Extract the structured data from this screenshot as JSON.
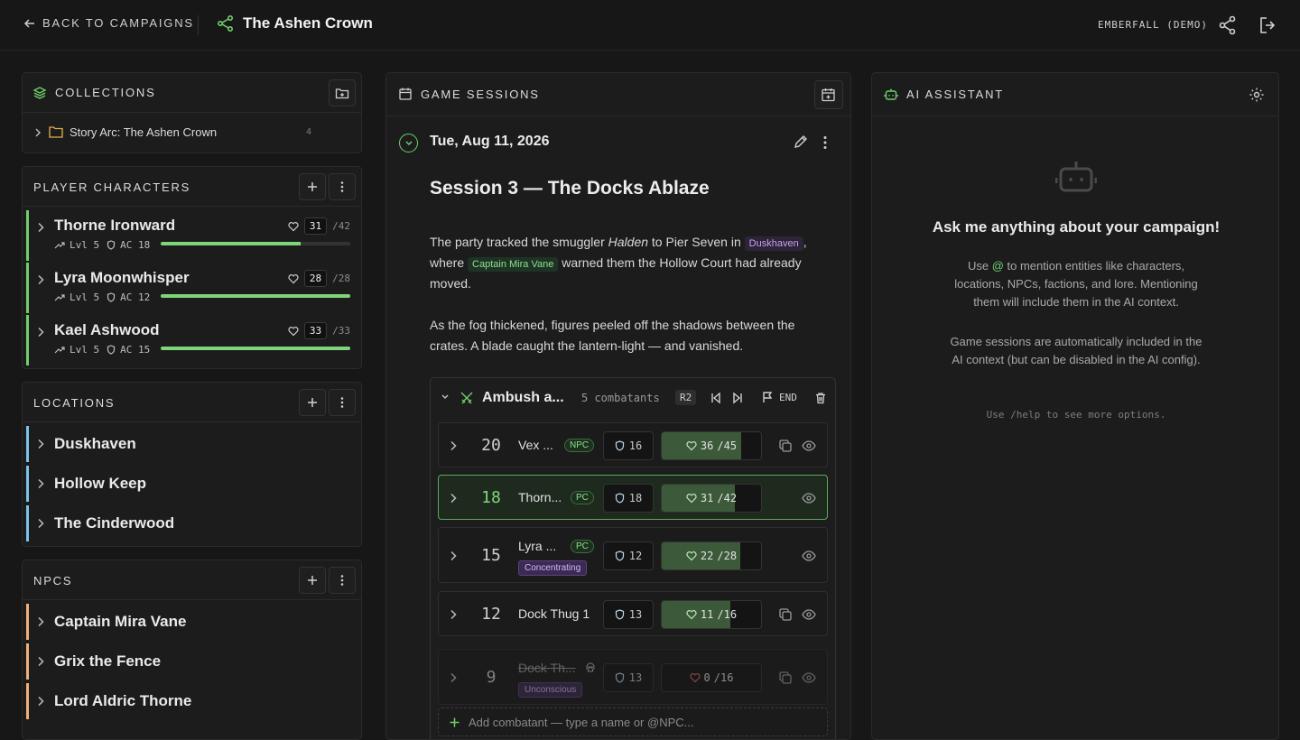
{
  "topbar": {
    "back_label": "BACK TO CAMPAIGNS",
    "campaign_title": "The Ashen Crown",
    "world_label": "EMBERFALL (DEMO)"
  },
  "collections": {
    "header": "COLLECTIONS",
    "items": [
      {
        "label": "Story Arc: The Ashen Crown",
        "count": "4"
      }
    ]
  },
  "player_characters": {
    "header": "PLAYER CHARACTERS",
    "items": [
      {
        "name": "Thorne Ironward",
        "level": "Lvl 5",
        "ac": "AC 18",
        "hp": "31",
        "hp_max": "/42",
        "hp_fraction": 0.74
      },
      {
        "name": "Lyra Moonwhisper",
        "level": "Lvl 5",
        "ac": "AC 12",
        "hp": "28",
        "hp_max": "/28",
        "hp_fraction": 1.0
      },
      {
        "name": "Kael Ashwood",
        "level": "Lvl 5",
        "ac": "AC 15",
        "hp": "33",
        "hp_max": "/33",
        "hp_fraction": 1.0
      }
    ]
  },
  "locations": {
    "header": "LOCATIONS",
    "items": [
      {
        "name": "Duskhaven"
      },
      {
        "name": "Hollow Keep"
      },
      {
        "name": "The Cinderwood"
      }
    ]
  },
  "npcs": {
    "header": "NPCS",
    "items": [
      {
        "name": "Captain Mira Vane"
      },
      {
        "name": "Grix the Fence"
      },
      {
        "name": "Lord Aldric Thorne"
      }
    ]
  },
  "sessions": {
    "header": "GAME SESSIONS",
    "date": "Tue, Aug 11, 2026",
    "title": "Session 3 — The Docks Ablaze",
    "para1_a": "The party tracked the smuggler ",
    "para1_em": "Halden",
    "para1_b": " to Pier Seven in ",
    "para1_tag_loc": "Duskhaven",
    "para1_c": ",",
    "para1_d": "where ",
    "para1_tag_npc": "Captain Mira Vane",
    "para1_e": " warned them the Hollow Court had already moved.",
    "para2": "As the fog thickened, figures peeled off the shadows between the crates. A blade caught the lantern-light — and vanished."
  },
  "combat": {
    "title": "Ambush a...",
    "combatants_label": "5 combatants",
    "round": "R2",
    "end_label": "END",
    "add_placeholder": "Add combatant — type a name or @NPC...",
    "rows": [
      {
        "initiative": "20",
        "name": "Vex ...",
        "badge": "NPC",
        "ac": "16",
        "hp": "36",
        "hp_max": "/45",
        "hp_fraction": 0.8,
        "status": ""
      },
      {
        "initiative": "18",
        "name": "Thorn...",
        "badge": "PC",
        "ac": "18",
        "hp": "31",
        "hp_max": "/42",
        "hp_fraction": 0.74,
        "status": ""
      },
      {
        "initiative": "15",
        "name": "Lyra ...",
        "badge": "PC",
        "ac": "12",
        "hp": "22",
        "hp_max": "/28",
        "hp_fraction": 0.79,
        "status": "Concentrating"
      },
      {
        "initiative": "12",
        "name": "Dock Thug 1",
        "badge": "",
        "ac": "13",
        "hp": "11",
        "hp_max": "/16",
        "hp_fraction": 0.69,
        "status": ""
      },
      {
        "initiative": "9",
        "name": "Dock Th...",
        "badge": "",
        "ac": "13",
        "hp": "0",
        "hp_max": "/16",
        "hp_fraction": 0.0,
        "status": "Unconscious"
      }
    ]
  },
  "assistant": {
    "header": "AI ASSISTANT",
    "headline": "Ask me anything about your campaign!",
    "desc1_a": "Use ",
    "desc1_at": "@",
    "desc1_b": " to mention entities like characters, locations, NPCs, factions, and lore. Mentioning them will include them in the AI context.",
    "desc2": "Game sessions are automatically included in the AI context (but can be disabled in the AI config).",
    "hint": "Use /help to see more options."
  },
  "colors": {
    "accent_green": "#6fcf6b",
    "location_accent": "#7cc4e8",
    "npc_accent": "#f0b07a",
    "collection_folder": "#e8b04a"
  }
}
